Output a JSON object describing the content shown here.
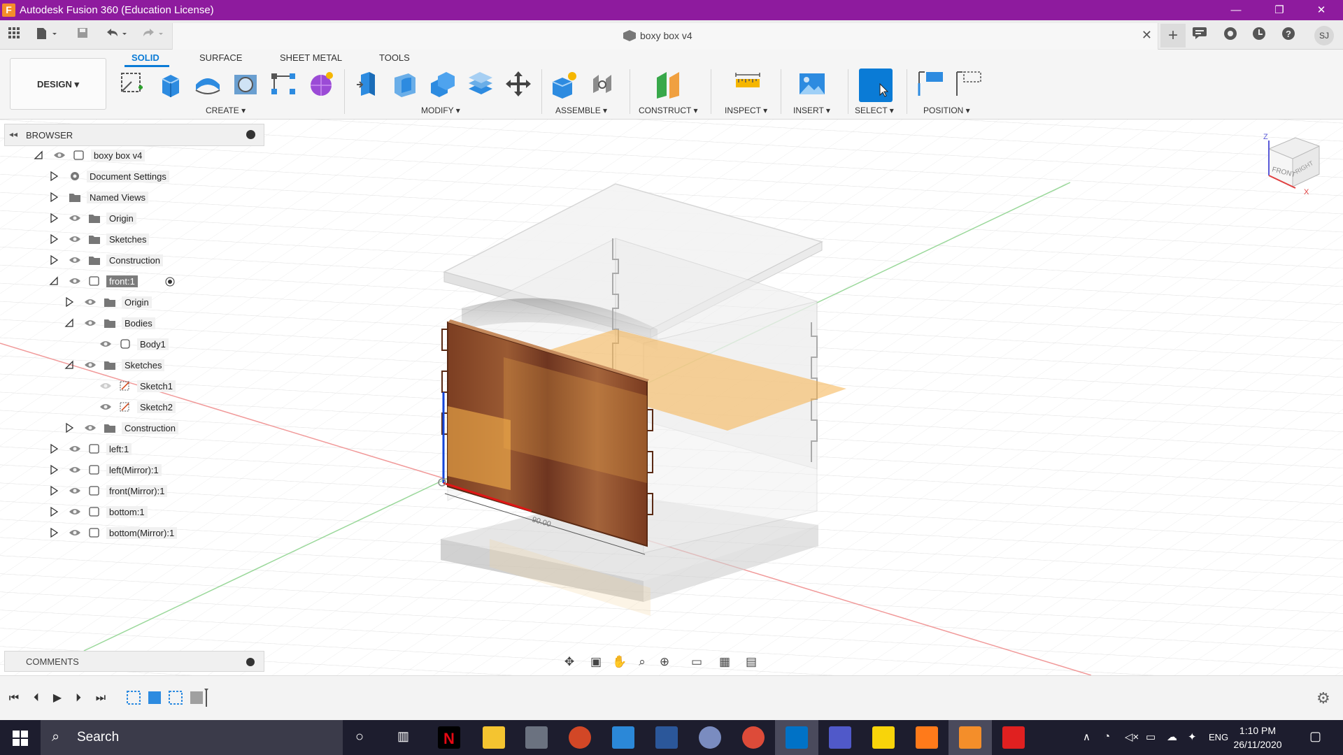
{
  "window": {
    "title": "Autodesk Fusion 360 (Education License)",
    "app_icon_letter": "F",
    "minimize": "—",
    "maximize": "❐",
    "close": "✕"
  },
  "document": {
    "title": "boxy box v4",
    "close": "✕"
  },
  "quick_access": {
    "new_tab": "+",
    "avatar": "SJ"
  },
  "toolbar": {
    "workspace": "DESIGN ▾",
    "tabs": [
      "SOLID",
      "SURFACE",
      "SHEET METAL",
      "TOOLS"
    ],
    "active_tab": "SOLID",
    "groups": [
      "CREATE ▾",
      "MODIFY ▾",
      "ASSEMBLE ▾",
      "CONSTRUCT ▾",
      "INSPECT ▾",
      "INSERT ▾",
      "SELECT ▾",
      "POSITION ▾"
    ]
  },
  "browser": {
    "title": "BROWSER",
    "items": [
      {
        "label": "boxy box v4",
        "icon": "component-icon"
      },
      {
        "label": "Document Settings",
        "icon": "gear-icon"
      },
      {
        "label": "Named Views",
        "icon": "folder-icon"
      },
      {
        "label": "Origin",
        "icon": "folder-icon"
      },
      {
        "label": "Sketches",
        "icon": "folder-icon"
      },
      {
        "label": "Construction",
        "icon": "folder-icon"
      },
      {
        "label": "front:1",
        "icon": "component-icon",
        "selected": true
      },
      {
        "label": "Origin",
        "icon": "folder-icon"
      },
      {
        "label": "Bodies",
        "icon": "folder-icon"
      },
      {
        "label": "Body1",
        "icon": "body-icon"
      },
      {
        "label": "Sketches",
        "icon": "folder-icon"
      },
      {
        "label": "Sketch1",
        "icon": "sketch-icon"
      },
      {
        "label": "Sketch2",
        "icon": "sketch-icon"
      },
      {
        "label": "Construction",
        "icon": "folder-icon"
      },
      {
        "label": "left:1",
        "icon": "component-icon"
      },
      {
        "label": "left(Mirror):1",
        "icon": "component-icon"
      },
      {
        "label": "front(Mirror):1",
        "icon": "component-icon"
      },
      {
        "label": "bottom:1",
        "icon": "component-icon"
      },
      {
        "label": "bottom(Mirror):1",
        "icon": "component-icon"
      }
    ]
  },
  "comments": {
    "title": "COMMENTS"
  },
  "viewcube": {
    "front": "FRONT",
    "right": "RIGHT",
    "z": "Z",
    "x": "X"
  },
  "dimension": {
    "text": "90.00"
  },
  "taskbar": {
    "search_placeholder": "Search",
    "language": "ENG",
    "time": "1:10 PM",
    "date": "26/11/2020"
  },
  "colors": {
    "titlebar": "#8e1b9e",
    "accent": "#0a7bd6",
    "wood": "#8a4a2a",
    "plane": "#f5b04b"
  }
}
